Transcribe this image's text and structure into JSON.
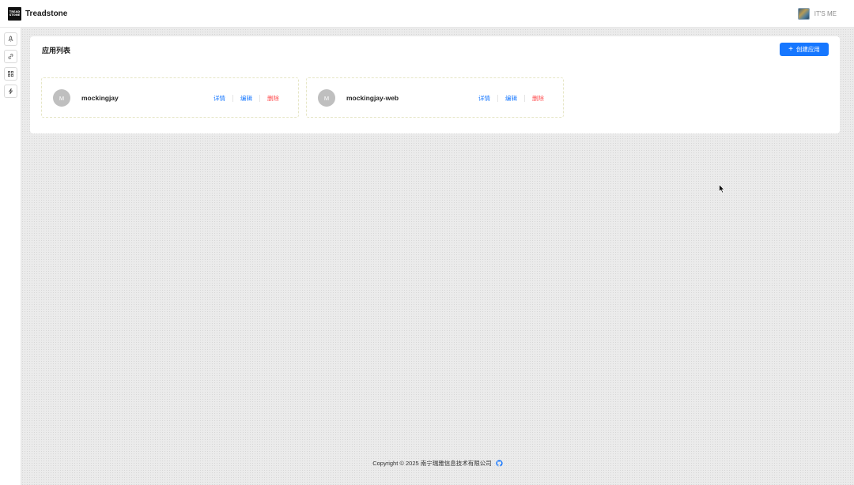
{
  "header": {
    "logo_line1": "TREAD",
    "logo_line2": "STONE",
    "title": "Treadstone",
    "user_name": "IT'S ME"
  },
  "sidebar": {
    "items": [
      {
        "icon": "rocket-icon"
      },
      {
        "icon": "link-icon"
      },
      {
        "icon": "grid-icon"
      },
      {
        "icon": "bolt-icon"
      }
    ]
  },
  "main": {
    "title": "应用列表",
    "create_button": "创建应用",
    "apps": [
      {
        "avatar": "M",
        "name": "mockingjay",
        "detail": "详情",
        "edit": "编辑",
        "delete": "删除"
      },
      {
        "avatar": "M",
        "name": "mockingjay-web",
        "detail": "详情",
        "edit": "编辑",
        "delete": "删除"
      }
    ]
  },
  "footer": {
    "copyright": "Copyright © 2025 南宁瑞雅信息技术有限公司"
  },
  "colors": {
    "primary": "#1677ff",
    "danger": "#ff4d4f",
    "avatar_gray": "#bfbfbf"
  }
}
